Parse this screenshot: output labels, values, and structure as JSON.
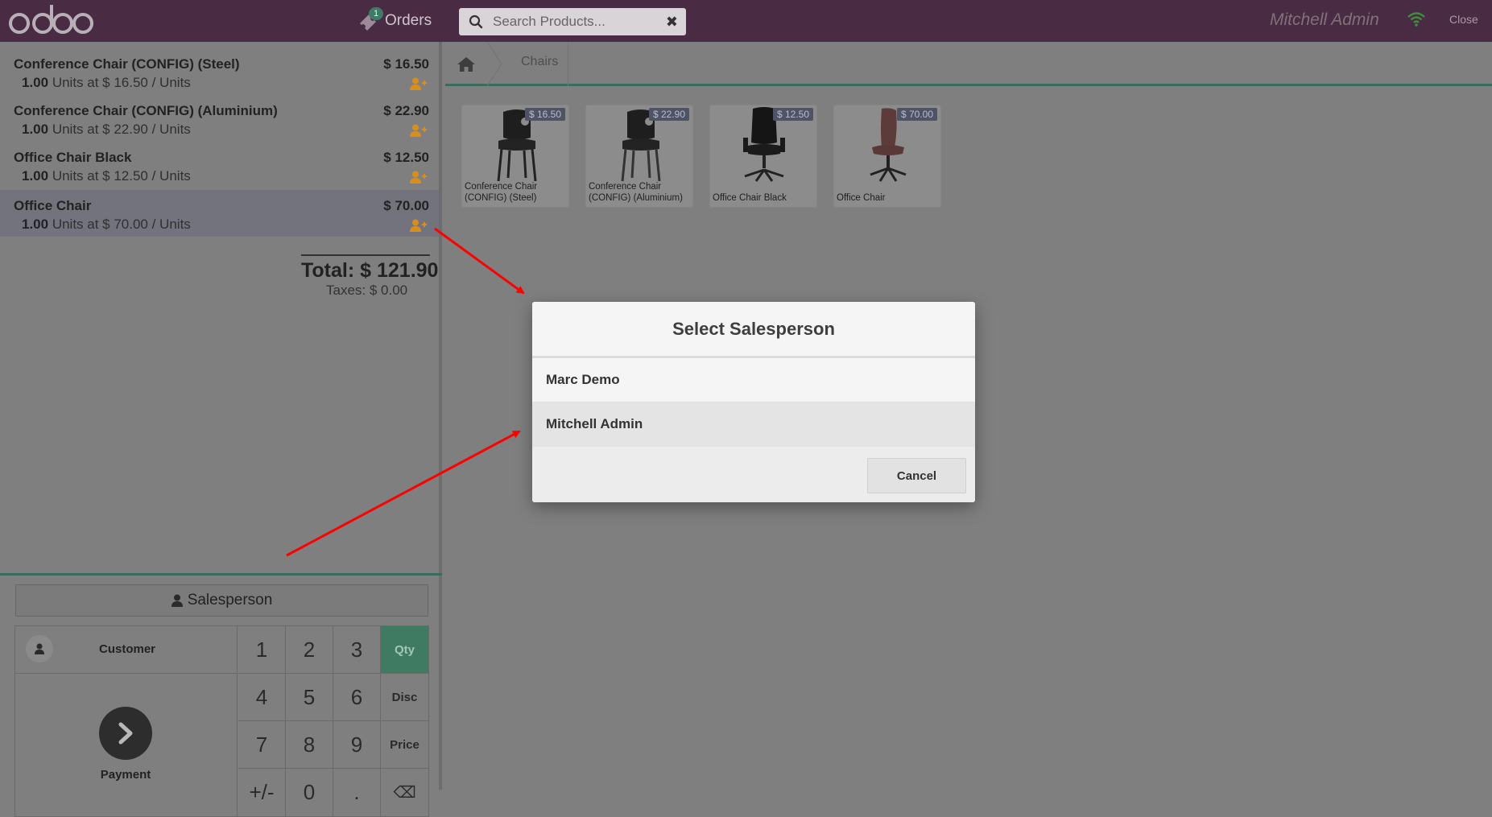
{
  "header": {
    "logo": "odoo",
    "orders_label": "Orders",
    "orders_count": "1",
    "search_placeholder": "Search Products...",
    "clear_icon": "✖",
    "user_name": "Mitchell Admin",
    "close_label": "Close"
  },
  "order": {
    "lines": [
      {
        "name": "Conference Chair (CONFIG) (Steel)",
        "price": "$ 16.50",
        "qty": "1.00",
        "detail": " Units at $ 16.50 / Units"
      },
      {
        "name": "Conference Chair (CONFIG) (Aluminium)",
        "price": "$ 22.90",
        "qty": "1.00",
        "detail": " Units at $ 22.90 / Units"
      },
      {
        "name": "Office Chair Black",
        "price": "$ 12.50",
        "qty": "1.00",
        "detail": " Units at $ 12.50 / Units"
      },
      {
        "name": "Office Chair",
        "price": "$ 70.00",
        "qty": "1.00",
        "detail": " Units at $ 70.00 / Units"
      }
    ],
    "total": "Total: $ 121.90",
    "taxes": "Taxes: $ 0.00"
  },
  "controls": {
    "salesperson_label": "Salesperson",
    "customer_label": "Customer",
    "payment_label": "Payment",
    "keys": {
      "k1": "1",
      "k2": "2",
      "k3": "3",
      "qty": "Qty",
      "k4": "4",
      "k5": "5",
      "k6": "6",
      "disc": "Disc",
      "k7": "7",
      "k8": "8",
      "k9": "9",
      "price": "Price",
      "sign": "+/-",
      "k0": "0",
      "dot": ".",
      "backspace": "⌫"
    },
    "active_mode": "Qty"
  },
  "products": {
    "breadcrumb": "Chairs",
    "items": [
      {
        "name": "Conference Chair (CONFIG) (Steel)",
        "price": "$ 16.50"
      },
      {
        "name": "Conference Chair (CONFIG) (Aluminium)",
        "price": "$ 22.90"
      },
      {
        "name": "Office Chair Black",
        "price": "$ 12.50"
      },
      {
        "name": "Office Chair",
        "price": "$ 70.00"
      }
    ]
  },
  "modal": {
    "title": "Select Salesperson",
    "options": [
      "Marc Demo",
      "Mitchell Admin"
    ],
    "cancel_label": "Cancel"
  },
  "colors": {
    "header_bg": "#492c44",
    "accent_green": "#3f7a63",
    "annotation_arrow": "#ff0000"
  }
}
